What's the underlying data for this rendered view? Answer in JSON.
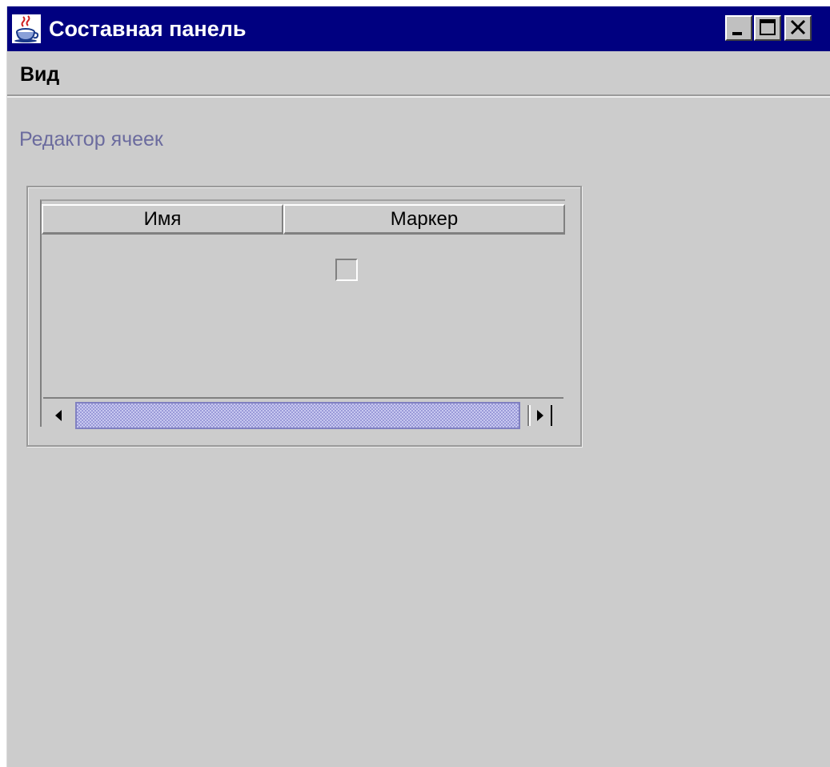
{
  "window": {
    "title": "Составная панель"
  },
  "menubar": {
    "items": [
      {
        "label": "Вид"
      }
    ]
  },
  "panel": {
    "section_label": "Редактор ячеек",
    "table": {
      "columns": [
        "Имя",
        "Маркер"
      ],
      "rows": [
        {
          "name": "",
          "marker_checked": false
        }
      ]
    }
  },
  "icons": {
    "app": "java-coffee-cup-icon",
    "minimize": "minimize-icon",
    "maximize": "maximize-icon",
    "close": "close-icon",
    "scroll_left": "arrow-left-icon",
    "scroll_right": "arrow-right-icon"
  },
  "colors": {
    "titlebar": "#000080",
    "background": "#cccccc",
    "section_label": "#6b6b9e",
    "scroll_thumb": "#c8c8f0"
  }
}
